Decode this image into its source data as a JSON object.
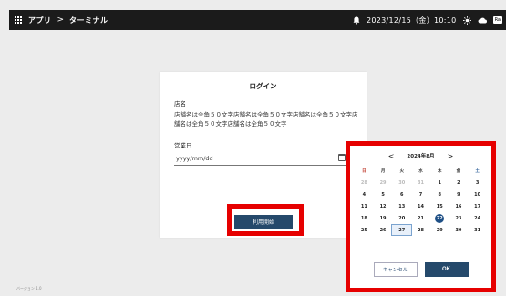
{
  "topbar": {
    "breadcrumb": [
      "アプリ",
      "ターミナル"
    ],
    "separator": ">",
    "datetime": "2023/12/15（金）10:10",
    "brand": "Ra"
  },
  "login": {
    "title": "ログイン",
    "store_label": "店名",
    "store_value": "店舗名は全角５０文字店舗名は全角５０文字店舗名は全角５０文字店舗名は全角５０文字店舗名は全角５０文字",
    "date_label": "営業日",
    "date_placeholder": "yyyy/mm/dd",
    "start_button": "利用開始"
  },
  "calendar": {
    "month_label": "2024年8月",
    "prev": "<",
    "next": ">",
    "weekdays": [
      "日",
      "月",
      "火",
      "水",
      "木",
      "金",
      "土"
    ],
    "weeks": [
      [
        "28",
        "29",
        "30",
        "31",
        "1",
        "2",
        "3"
      ],
      [
        "4",
        "5",
        "6",
        "7",
        "8",
        "9",
        "10"
      ],
      [
        "11",
        "12",
        "13",
        "14",
        "15",
        "16",
        "17"
      ],
      [
        "18",
        "19",
        "20",
        "21",
        "22",
        "23",
        "24"
      ],
      [
        "25",
        "26",
        "27",
        "28",
        "29",
        "30",
        "31"
      ]
    ],
    "today": "22",
    "selected": "27",
    "cancel": "キャンセル",
    "ok": "OK"
  },
  "footer": {
    "version": "バージョン 1.0"
  },
  "colors": {
    "accent": "#25496b",
    "highlight": "#e60000",
    "topbar": "#1b1b1b"
  }
}
